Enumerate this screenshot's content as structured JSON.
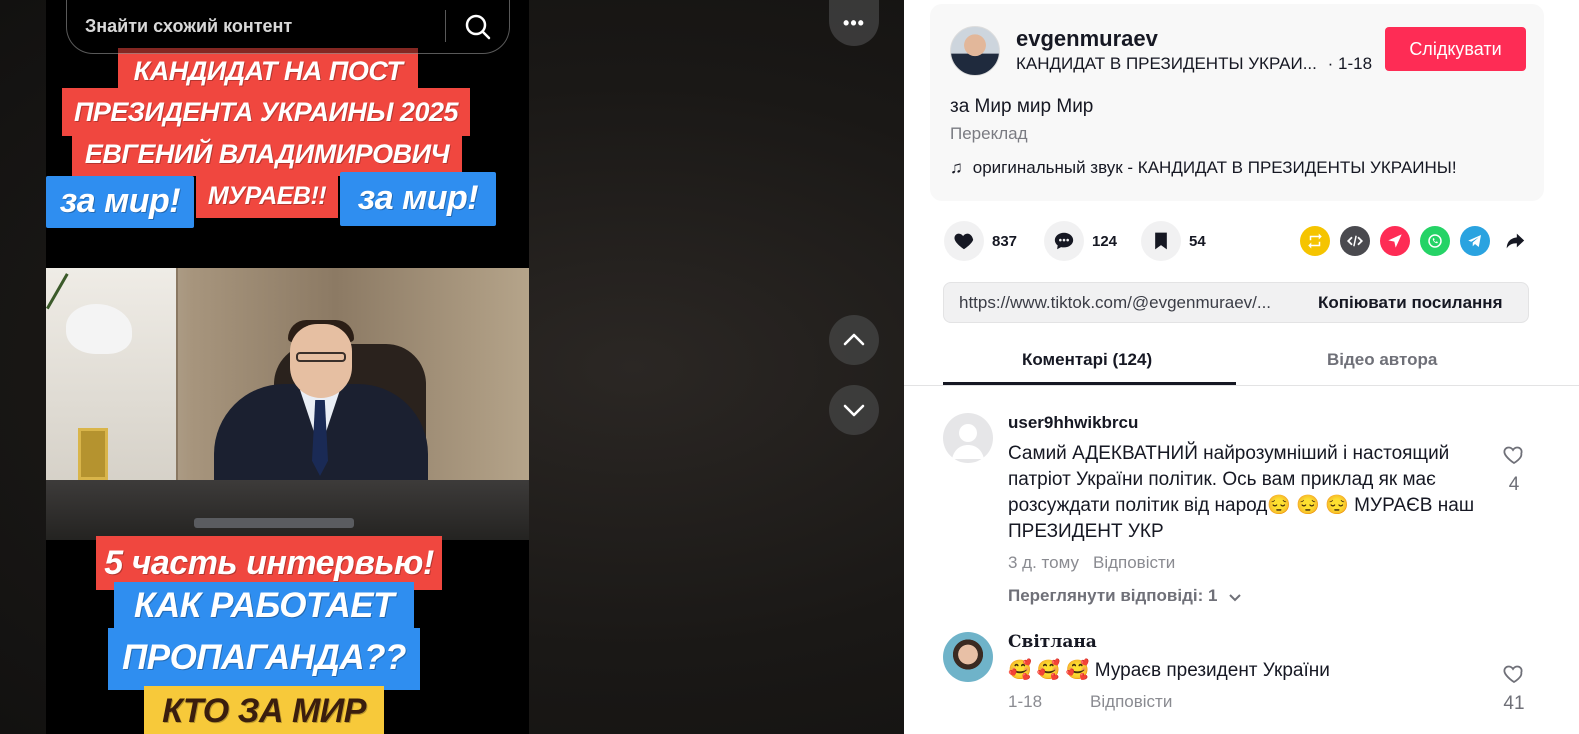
{
  "search": {
    "placeholder": "Знайти схожий контент"
  },
  "video": {
    "captions": {
      "line1": "КАНДИДАТ НА ПОСТ",
      "line2": "ПРЕЗИДЕНТА УКРАИНЫ 2025",
      "line3": "ЕВГЕНИЙ ВЛАДИМИРОВИЧ",
      "peace_left": "за мир!",
      "surname": "МУРАЕВ!!",
      "peace_right": "за мир!",
      "part": "5 часть интервью!",
      "how_works": "КАК РАБОТАЕТ",
      "propaganda": "ПРОПАГАНДА??",
      "who_for_peace": "КТО ЗА МИР"
    },
    "more_label": "•••"
  },
  "author": {
    "username": "evgenmuraev",
    "nickname": "КАНДИДАТ В ПРЕЗИДЕНТЫ УКРАИ...",
    "date": "· 1-18",
    "follow_label": "Слідкувати"
  },
  "post": {
    "description": "за Мир мир Мир",
    "translate_label": "Переклад",
    "sound": "оригинальный звук - КАНДИДАТ В ПРЕЗИДЕНТЫ УКРАИНЫ!"
  },
  "stats": {
    "likes": "837",
    "comments": "124",
    "saves": "54"
  },
  "share_colors": {
    "repost": "#f5c400",
    "embed": "#4a4a4f",
    "send": "#fe2c55",
    "whatsapp": "#25d366",
    "telegram": "#2aa3e0"
  },
  "link": {
    "url": "https://www.tiktok.com/@evgenmuraev/...",
    "copy_label": "Копіювати посилання"
  },
  "tabs": {
    "comments": "Коментарі (124)",
    "author_videos": "Відео автора"
  },
  "comments": [
    {
      "user": "user9hhwikbrcu",
      "text": "Самий АДЕКВАТНИЙ найрозумніший і настоящий патріот України політик. Ось вам приклад як має розсуждати політик від народ😔 😔 😔 МУРАЄВ наш ПРЕЗИДЕНТ УКР",
      "time": "3 д. тому",
      "reply_label": "Відповісти",
      "view_replies": "Переглянути відповіді: 1",
      "likes": "4"
    },
    {
      "user": "Світлана",
      "text": "🥰 🥰 🥰 Мураєв президент України",
      "time": "1-18",
      "reply_label": "Відповісти",
      "likes": "41"
    }
  ]
}
